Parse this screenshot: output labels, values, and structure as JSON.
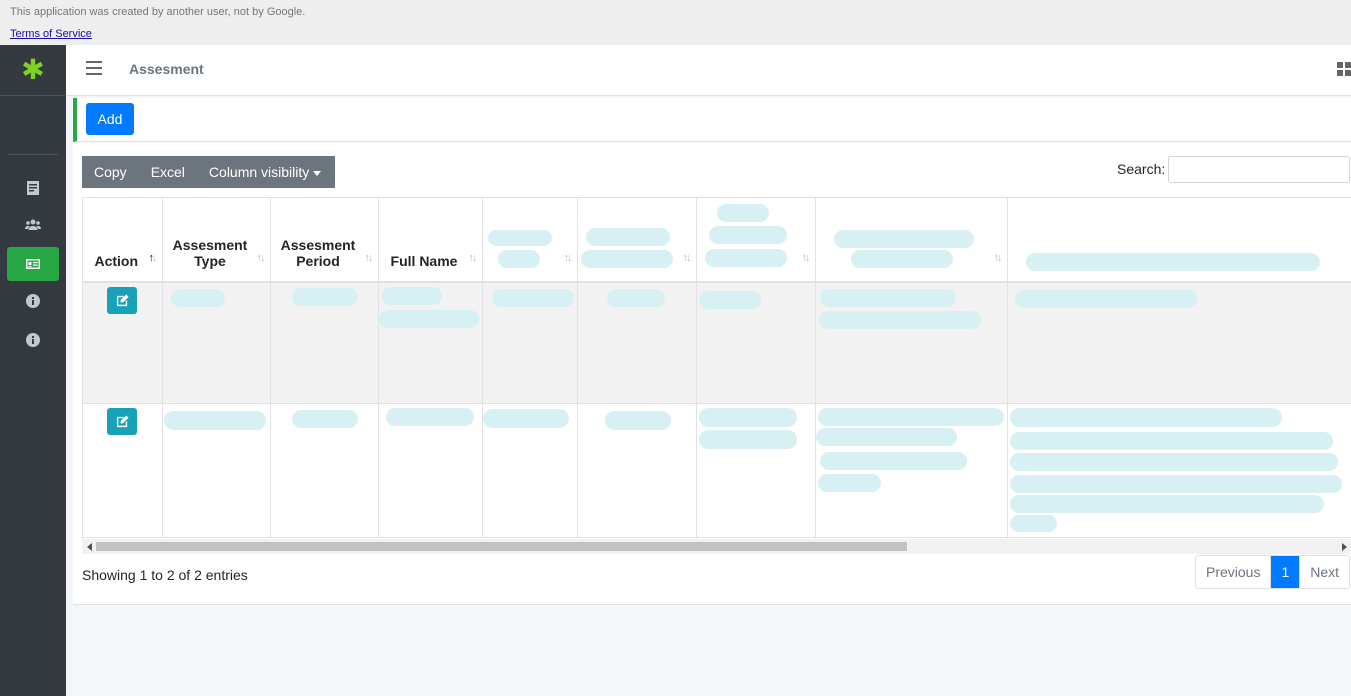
{
  "banner": {
    "message": "This application was created by another user, not by Google.",
    "terms": "Terms of Service"
  },
  "header": {
    "title": "Assesment"
  },
  "sidebar": {
    "items": [
      {
        "icon": "form-icon",
        "active": false
      },
      {
        "icon": "users-icon",
        "active": false
      },
      {
        "icon": "id-card-icon",
        "active": true
      },
      {
        "icon": "info-icon",
        "active": false
      },
      {
        "icon": "info-icon",
        "active": false
      }
    ]
  },
  "toolbar": {
    "add_label": "Add",
    "copy_label": "Copy",
    "excel_label": "Excel",
    "colvis_label": "Column visibility",
    "search_label": "Search:",
    "search_value": ""
  },
  "table": {
    "columns": [
      "Action",
      "Assesment Type",
      "Assesment Period",
      "Full Name",
      "",
      "",
      "",
      "",
      ""
    ],
    "sorted_column": "Action",
    "row_count": 2
  },
  "footer": {
    "info": "Showing 1 to 2 of 2 entries",
    "prev_label": "Previous",
    "page_label": "1",
    "next_label": "Next"
  },
  "colors": {
    "primary": "#007bff",
    "success": "#28a745",
    "info": "#17a2b8",
    "sidebar": "#343a40"
  }
}
